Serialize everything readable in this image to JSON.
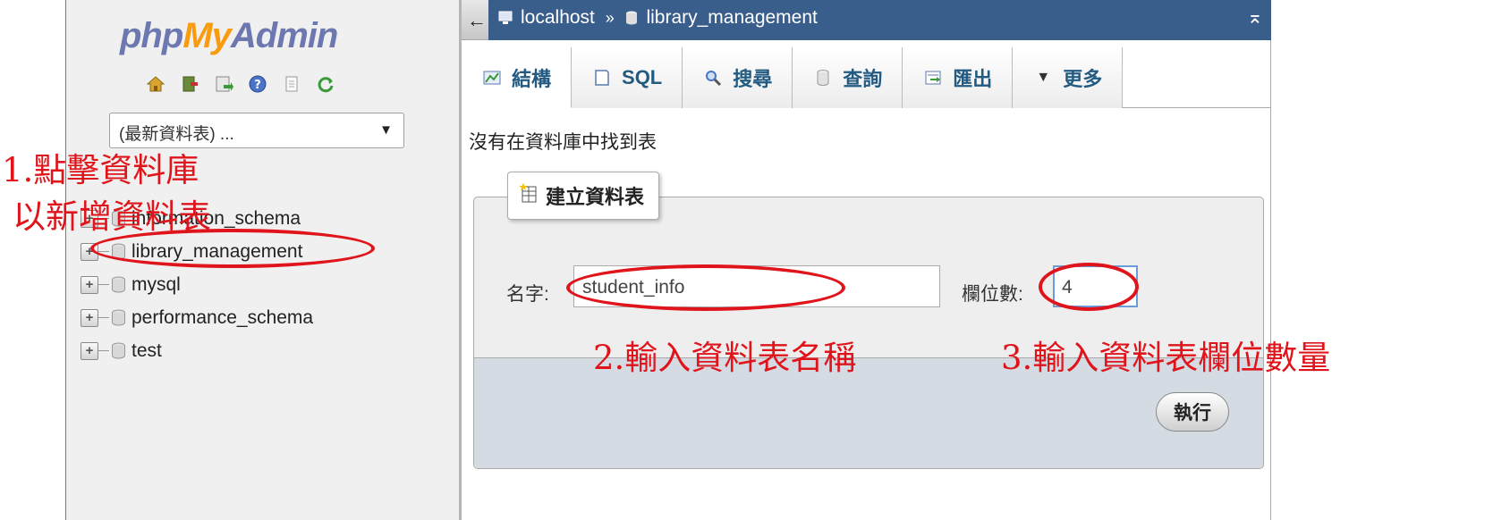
{
  "nav": {
    "logo": {
      "php": "php",
      "my": "My",
      "admin": "Admin"
    },
    "icons": [
      "home-icon",
      "exit-icon",
      "query-window-icon",
      "help-icon",
      "docs-icon",
      "reload-icon"
    ],
    "recent_select": "(最新資料表) ...",
    "databases": [
      {
        "name": "information_schema"
      },
      {
        "name": "library_management"
      },
      {
        "name": "mysql"
      },
      {
        "name": "performance_schema"
      },
      {
        "name": "test"
      }
    ]
  },
  "breadcrumb": {
    "back": "←",
    "server": "localhost",
    "separator": "»",
    "database": "library_management"
  },
  "tabs": [
    {
      "label": "結構",
      "icon": "structure-icon"
    },
    {
      "label": "SQL",
      "icon": "sql-icon"
    },
    {
      "label": "搜尋",
      "icon": "search-icon"
    },
    {
      "label": "查詢",
      "icon": "query-icon"
    },
    {
      "label": "匯出",
      "icon": "export-icon"
    },
    {
      "label": "更多",
      "icon": "chevron-down-icon"
    }
  ],
  "main": {
    "notice": "沒有在資料庫中找到表",
    "create_table": {
      "legend": "建立資料表",
      "name_label": "名字:",
      "name_value": "student_info",
      "columns_label": "欄位數:",
      "columns_value": "4",
      "go_label": "執行"
    }
  },
  "annotations": {
    "step1_line1": "1.點擊資料庫",
    "step1_line2": "以新增資料表",
    "step2": "2.輸入資料表名稱",
    "step3": "3.輸入資料表欄位數量"
  },
  "colors": {
    "annotation": "#e0141b",
    "breadcrumb_bg": "#3a5e8c",
    "tab_text": "#235a81"
  }
}
